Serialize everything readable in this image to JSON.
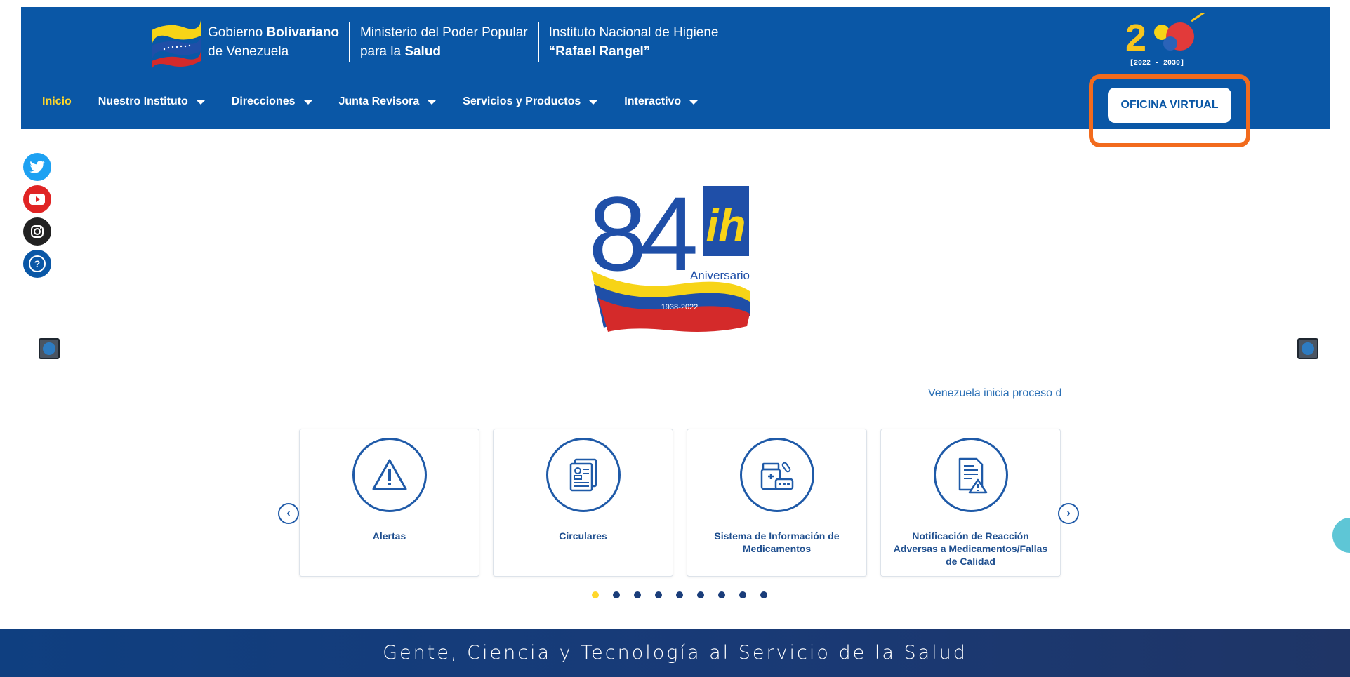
{
  "header": {
    "brand": {
      "gov_line1_pre": "Gobierno ",
      "gov_line1_bold": "Bolivariano",
      "gov_line2": "de Venezuela",
      "min_line1": "Ministerio del Poder Popular",
      "min_line2_pre": "para la ",
      "min_line2_bold": "Salud",
      "inst_line1": "Instituto Nacional de Higiene",
      "inst_line2": "“Rafael Rangel”"
    },
    "bicentenario": {
      "years": "[2022 - 2030]"
    },
    "nav": [
      {
        "label": "Inicio",
        "active": true
      },
      {
        "label": "Nuestro Instituto"
      },
      {
        "label": "Direcciones"
      },
      {
        "label": "Junta Revisora"
      },
      {
        "label": "Servicios y Productos"
      },
      {
        "label": "Interactivo"
      }
    ],
    "oficina_virtual": "OFICINA VIRTUAL"
  },
  "social": [
    "twitter-icon",
    "youtube-icon",
    "instagram-icon",
    "help-icon"
  ],
  "hero": {
    "number": "84",
    "aniversario": "Aniversario",
    "years": "1938-2022",
    "logo_letters": "ih"
  },
  "ticker": "Venezuela inicia proceso d",
  "cards": [
    {
      "label": "Alertas",
      "icon": "warning-icon"
    },
    {
      "label": "Circulares",
      "icon": "documents-icon"
    },
    {
      "label": "Sistema de Información de Medicamentos",
      "icon": "medicine-icon"
    },
    {
      "label": "Notificación de Reacción Adversas a Medicamentos/Fallas de Calidad",
      "icon": "report-icon"
    }
  ],
  "pagination": {
    "total": 9,
    "active": 1
  },
  "footer": {
    "tagline": "Gente, Ciencia y Tecnología al Servicio de la Salud"
  },
  "colors": {
    "header_blue": "#0a57a6",
    "accent_yellow": "#ffd72a",
    "highlight_orange": "#f26b1d"
  }
}
